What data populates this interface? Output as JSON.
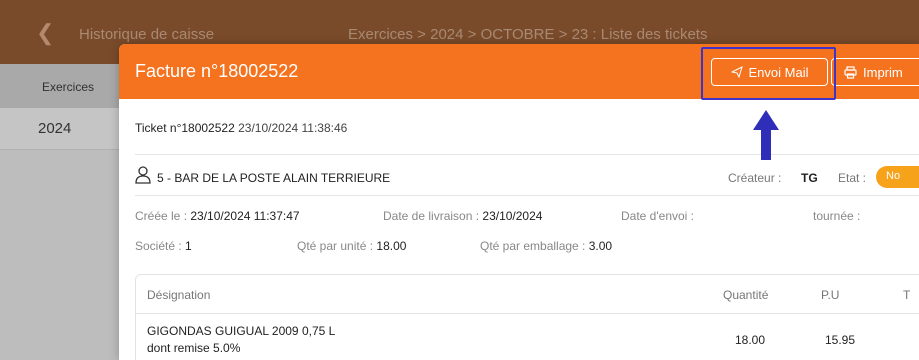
{
  "background": {
    "back_icon": "chevron-left-icon",
    "title": "Historique de caisse",
    "breadcrumb": "Exercices > 2024 > OCTOBRE > 23 : Liste des tickets",
    "sidebar_header": "Exercices",
    "sidebar_item": "2024"
  },
  "modal": {
    "title": "Facture n°18002522",
    "mail_button": "Envoi Mail",
    "print_button": "Imprim",
    "ticket_label": "Ticket n°18002522",
    "ticket_date": "23/10/2024 11:38:46",
    "client": "5 - BAR DE LA POSTE ALAIN TERRIEURE",
    "creator_label": "Créateur :",
    "creator_value": "TG",
    "etat_label": "Etat :",
    "etat_value": "No",
    "created_label": "Créée le :",
    "created_value": "23/10/2024 11:37:47",
    "delivery_label": "Date de livraison :",
    "delivery_value": "23/10/2024",
    "sent_label": "Date d'envoi :",
    "round_label": "tournée :",
    "company_label": "Société :",
    "company_value": "1",
    "qty_unit_label": "Qté par unité :",
    "qty_unit_value": "18.00",
    "qty_pack_label": "Qté par emballage :",
    "qty_pack_value": "3.00"
  },
  "table": {
    "headers": [
      "Désignation",
      "Quantité",
      "P.U",
      "T"
    ],
    "rows": [
      {
        "designation": "GIGONDAS GUIGUAL  2009 0,75 L",
        "remise": "dont remise 5.0%",
        "quantite": "18.00",
        "pu": "15.95"
      }
    ]
  },
  "colors": {
    "accent": "#f5731f",
    "highlight": "#3d33c8",
    "badge": "#f7a21b"
  }
}
